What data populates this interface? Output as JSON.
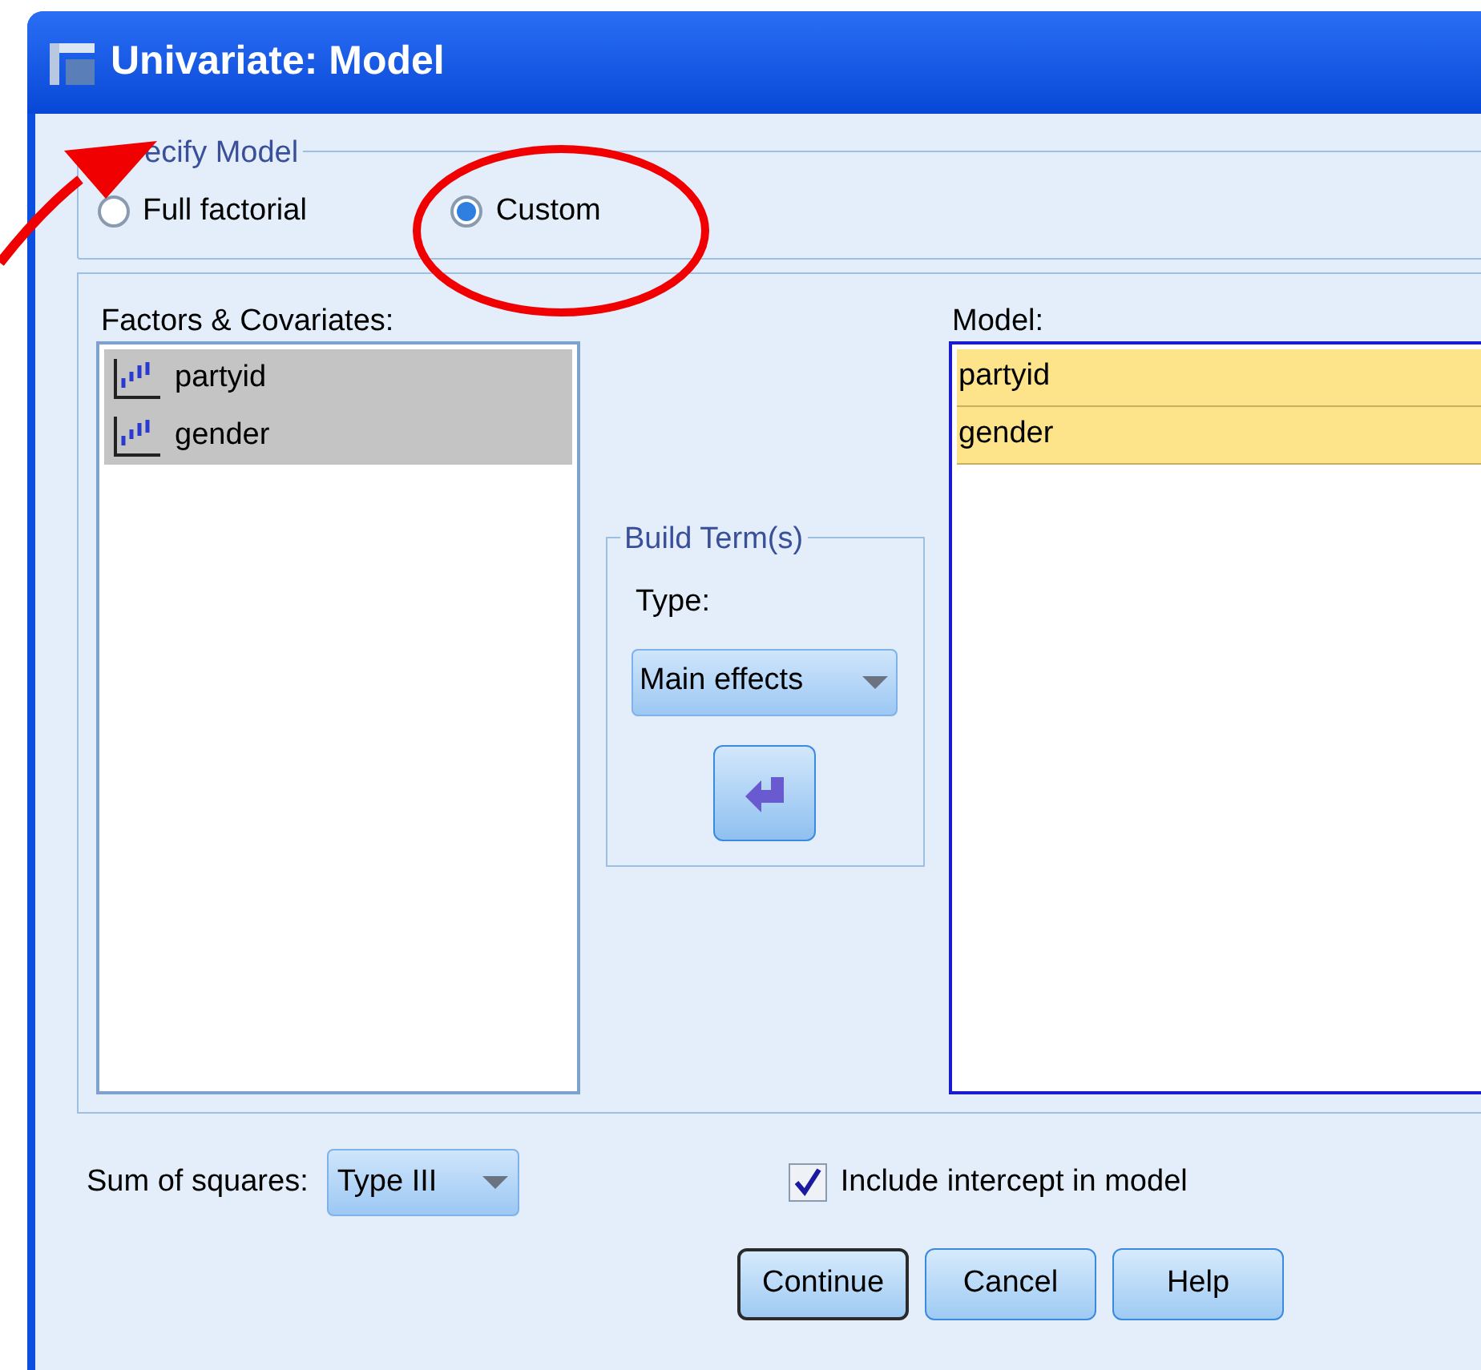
{
  "window": {
    "title": "Univariate: Model"
  },
  "specify_model": {
    "legend": "ecify Model",
    "options": [
      {
        "label": "Full factorial",
        "selected": false
      },
      {
        "label": "Custom",
        "selected": true
      }
    ]
  },
  "factors": {
    "label": "Factors & Covariates:",
    "items": [
      {
        "name": "partyid",
        "selected": true
      },
      {
        "name": "gender",
        "selected": true
      }
    ]
  },
  "build_terms": {
    "legend": "Build Term(s)",
    "type_label": "Type:",
    "type_value": "Main effects"
  },
  "model": {
    "label": "Model:",
    "items": [
      {
        "name": "partyid"
      },
      {
        "name": "gender"
      }
    ]
  },
  "sum_of_squares": {
    "label": "Sum of squares:",
    "value": "Type III"
  },
  "include_intercept": {
    "label": "Include intercept in model",
    "checked": true
  },
  "buttons": [
    {
      "label": "Continue",
      "default": true
    },
    {
      "label": "Cancel",
      "default": false
    },
    {
      "label": "Help",
      "default": false
    }
  ]
}
